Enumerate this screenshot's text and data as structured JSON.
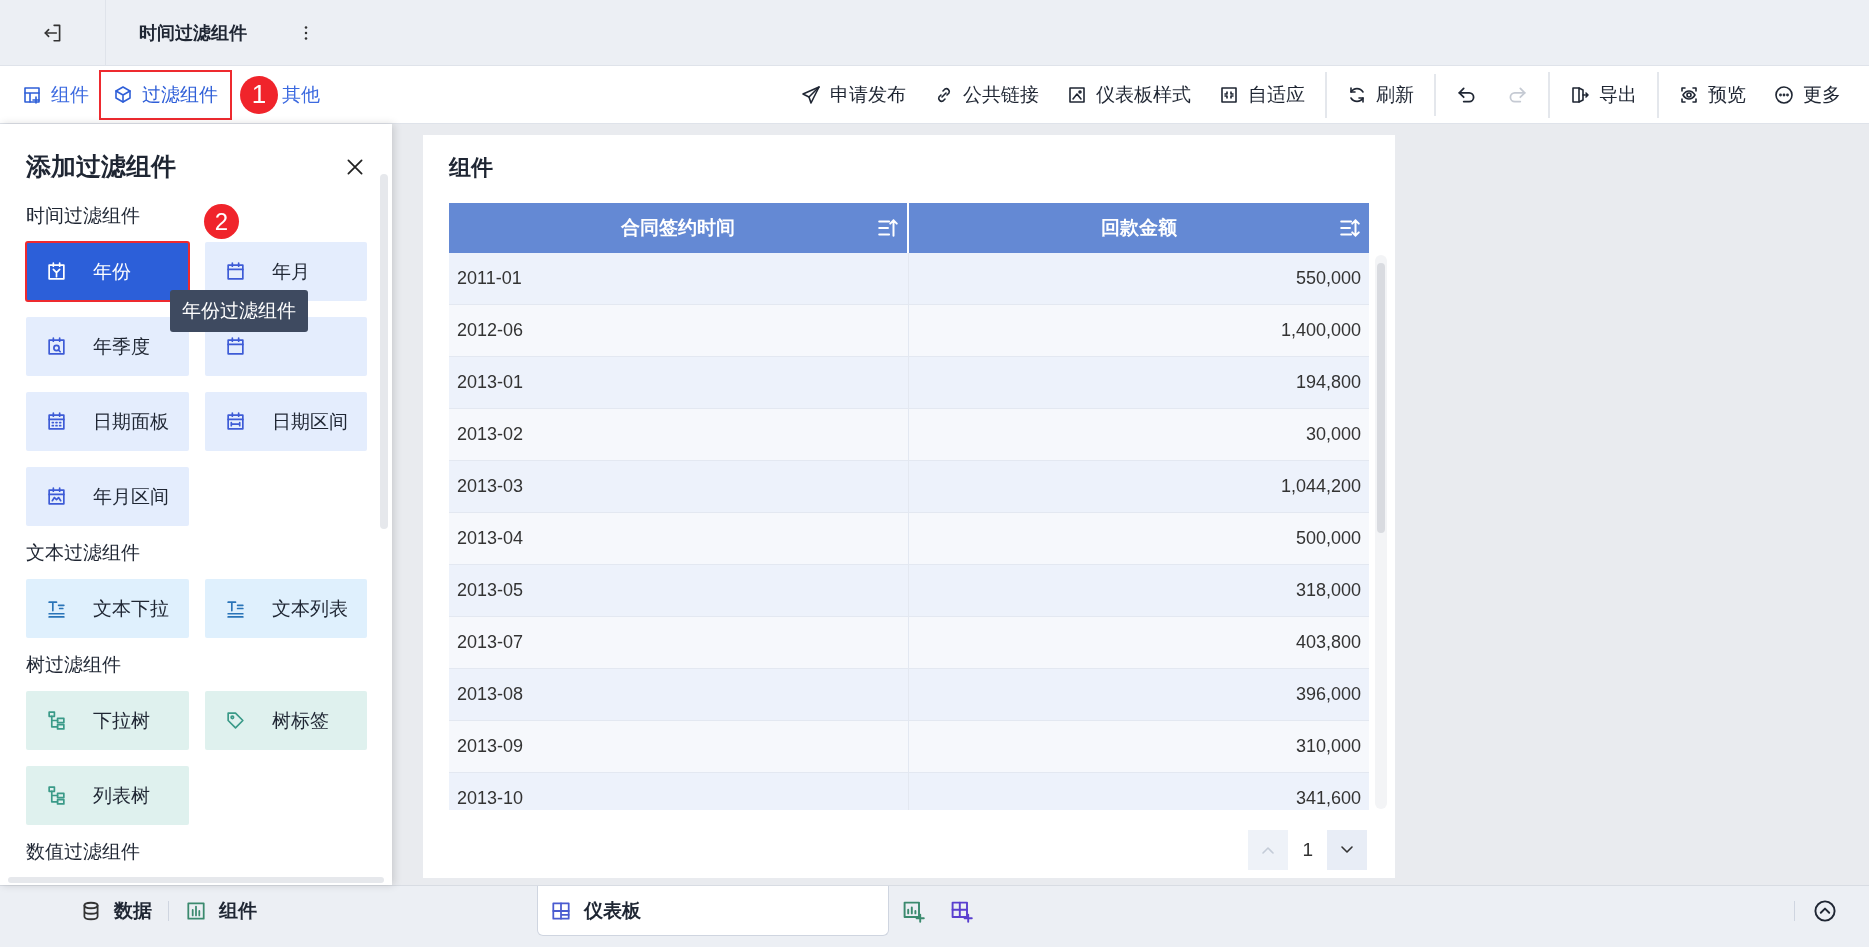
{
  "header": {
    "title": "时间过滤组件"
  },
  "toolbar": {
    "left": [
      {
        "label": "组件",
        "selected": false,
        "highlighted": false
      },
      {
        "label": "过滤组件",
        "selected": true,
        "highlighted": true
      },
      {
        "label": "其他",
        "selected": false,
        "highlighted": false
      }
    ],
    "marker": "1",
    "groups": [
      [
        {
          "label": "申请发布"
        },
        {
          "label": "公共链接"
        },
        {
          "label": "仪表板样式"
        },
        {
          "label": "自适应"
        }
      ],
      [
        {
          "label": "刷新"
        }
      ],
      [
        {
          "kind": "icon",
          "disabled": false
        },
        {
          "kind": "icon",
          "disabled": true
        }
      ],
      [
        {
          "label": "导出"
        }
      ],
      [
        {
          "label": "预览"
        },
        {
          "label": "更多"
        }
      ]
    ]
  },
  "panel": {
    "title": "添加过滤组件",
    "tooltip": "年份过滤组件",
    "marker": "2",
    "sections": [
      {
        "title": "时间过滤组件",
        "kind": "time",
        "items": [
          {
            "label": "年份",
            "selected": true,
            "highlighted": true
          },
          {
            "label": "年月",
            "selected": false,
            "highlighted": false
          },
          {
            "label": "年季度",
            "selected": false,
            "highlighted": false
          },
          {
            "selected": false,
            "highlighted": false
          },
          {
            "label": "日期面板",
            "selected": false,
            "highlighted": false
          },
          {
            "label": "日期区间",
            "selected": false,
            "highlighted": false
          },
          {
            "label": "年月区间",
            "selected": false,
            "highlighted": false
          }
        ]
      },
      {
        "title": "文本过滤组件",
        "kind": "text",
        "items": [
          {
            "label": "文本下拉",
            "selected": false,
            "highlighted": false
          },
          {
            "label": "文本列表",
            "selected": false,
            "highlighted": false
          }
        ]
      },
      {
        "title": "树过滤组件",
        "kind": "tree",
        "items": [
          {
            "label": "下拉树",
            "selected": false,
            "highlighted": false
          },
          {
            "label": "树标签",
            "selected": false,
            "highlighted": false
          },
          {
            "label": "列表树",
            "selected": false,
            "highlighted": false
          }
        ]
      },
      {
        "title": "数值过滤组件",
        "kind": "number"
      }
    ]
  },
  "card": {
    "title": "组件",
    "table": {
      "columns": [
        {
          "label": "合同签约时间"
        },
        {
          "label": "回款金额"
        }
      ],
      "rows": [
        [
          "2011-01",
          "550,000"
        ],
        [
          "2012-06",
          "1,400,000"
        ],
        [
          "2013-01",
          "194,800"
        ],
        [
          "2013-02",
          "30,000"
        ],
        [
          "2013-03",
          "1,044,200"
        ],
        [
          "2013-04",
          "500,000"
        ],
        [
          "2013-05",
          "318,000"
        ],
        [
          "2013-07",
          "403,800"
        ],
        [
          "2013-08",
          "396,000"
        ],
        [
          "2013-09",
          "310,000"
        ],
        [
          "2013-10",
          "341,600"
        ]
      ]
    },
    "pagination": {
      "page": "1",
      "prev_disabled": true
    }
  },
  "bottom": {
    "tabs": [
      {
        "label": "数据",
        "selected": false
      },
      {
        "label": "组件",
        "selected": false
      },
      {
        "label": "仪表板",
        "selected": true
      }
    ]
  }
}
